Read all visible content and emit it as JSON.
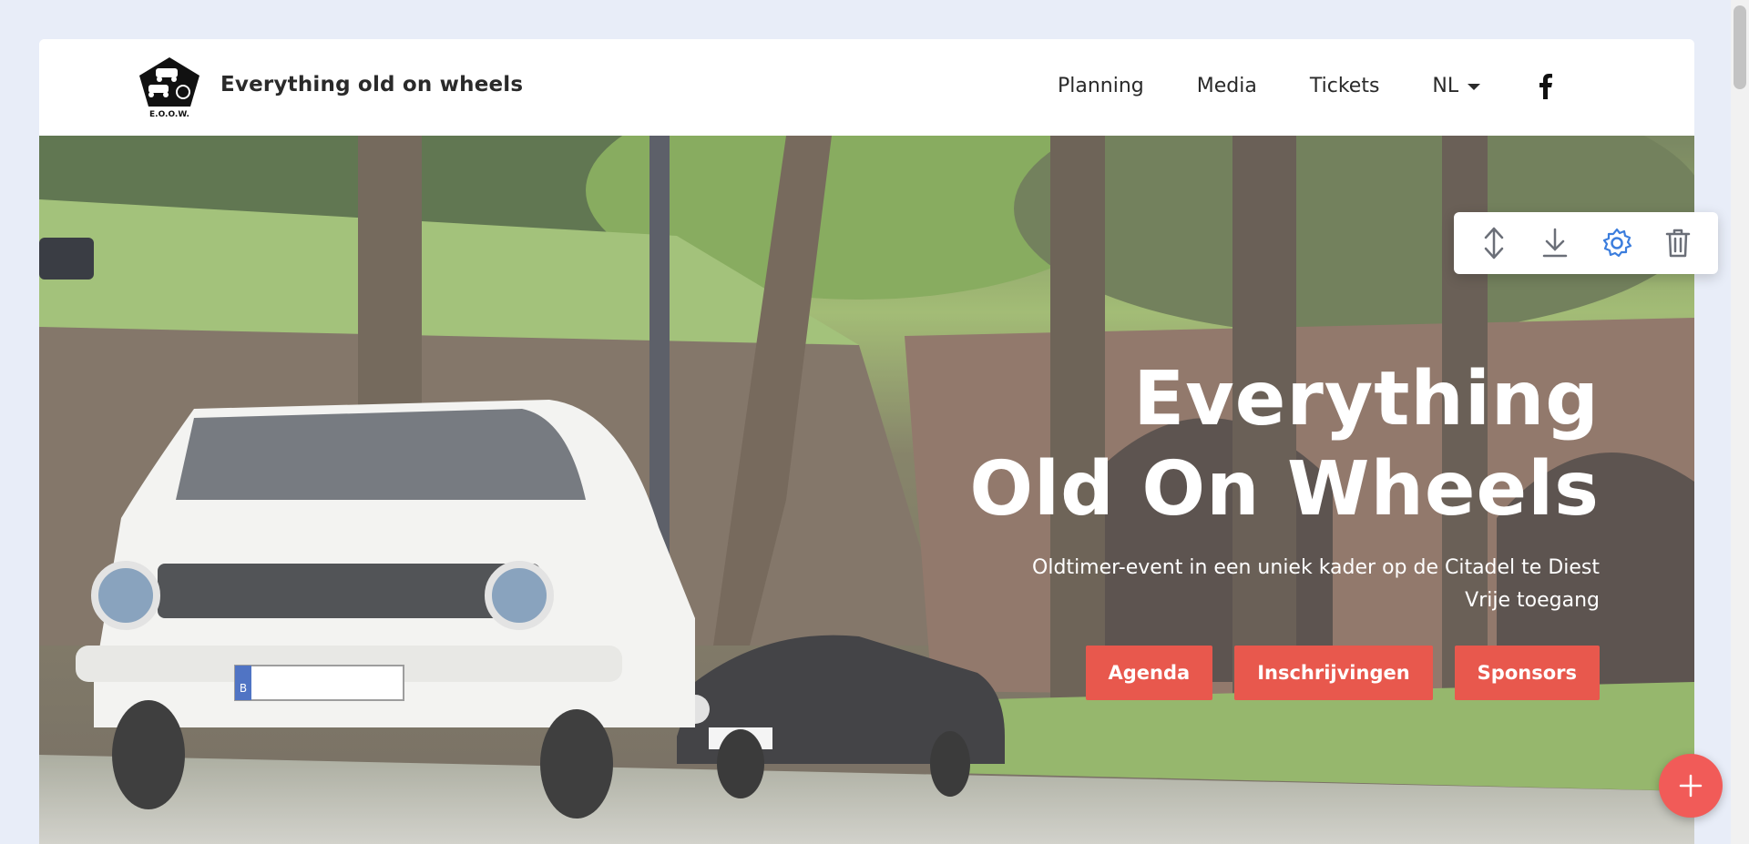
{
  "header": {
    "brand": "Everything old on wheels",
    "logo_text": "E.O.O.W.",
    "nav": [
      "Planning",
      "Media",
      "Tickets"
    ],
    "language": "NL",
    "social_icon": "facebook-icon"
  },
  "hero": {
    "title_line1": "Everything",
    "title_line2": "Old On Wheels",
    "subtitle_line1": "Oldtimer-event in een uniek kader op de Citadel te Diest",
    "subtitle_line2": "Vrije toegang",
    "buttons": [
      "Agenda",
      "Inschrijvingen",
      "Sponsors"
    ],
    "license_plate_letter": "B"
  },
  "editor_toolbar": {
    "tools": [
      "move-vertical-icon",
      "download-icon",
      "settings-gear-icon",
      "trash-icon"
    ],
    "active_color": "#3b7ddd"
  },
  "colors": {
    "accent": "#e8584d",
    "fab": "#f15b58",
    "page_bg": "#e8edf8"
  }
}
